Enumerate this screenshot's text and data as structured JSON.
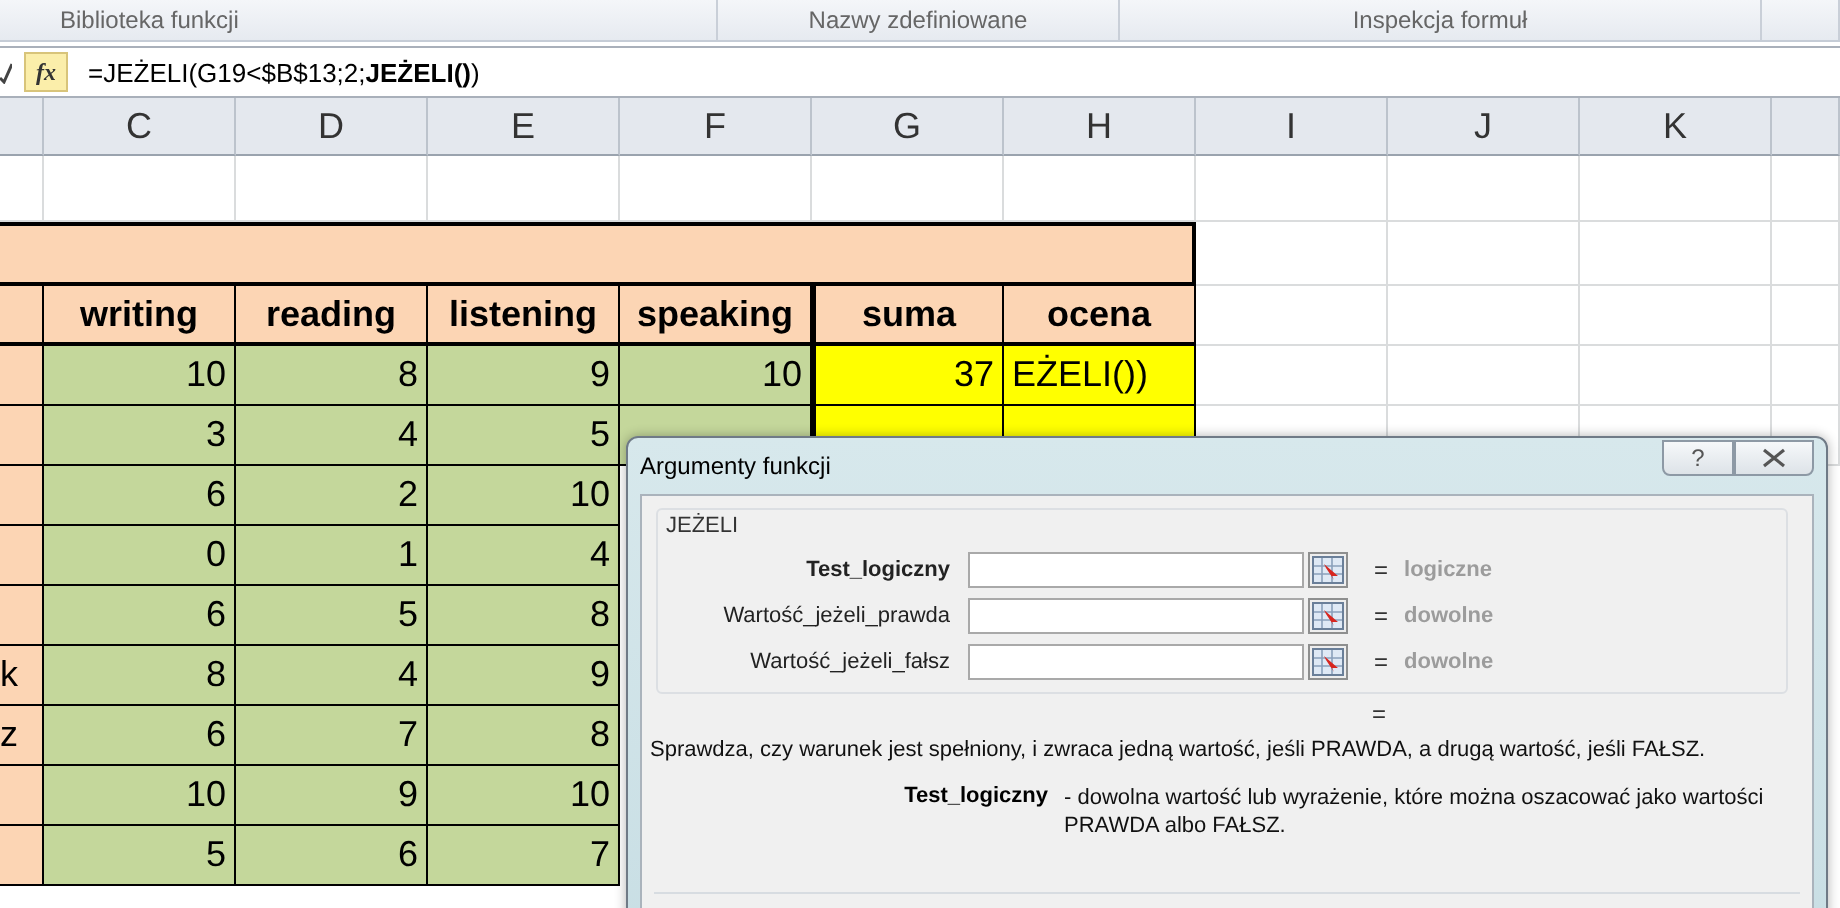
{
  "ribbon": {
    "groups": [
      "Biblioteka funkcji",
      "Nazwy zdefiniowane",
      "Inspekcja formuł"
    ]
  },
  "formula_bar": {
    "function_button": "fx",
    "formula": "=JEŻELI(G19<$B$13;2;**JEŻELI()**)"
  },
  "sheet": {
    "column_headers": [
      "C",
      "D",
      "E",
      "F",
      "G",
      "H",
      "I",
      "J",
      "K"
    ],
    "header_row": [
      "writing",
      "reading",
      "listening",
      "speaking",
      "suma",
      "ocena"
    ],
    "rows": [
      {
        "column_b": "",
        "values": [
          "10",
          "8",
          "9",
          "10",
          "37",
          "EŻELI())"
        ]
      },
      {
        "column_b": "",
        "values": [
          "3",
          "4",
          "5"
        ]
      },
      {
        "column_b": "",
        "values": [
          "6",
          "2",
          "10"
        ]
      },
      {
        "column_b": "",
        "values": [
          "0",
          "1",
          "4"
        ]
      },
      {
        "column_b": "",
        "values": [
          "6",
          "5",
          "8"
        ]
      },
      {
        "column_b": "k",
        "values": [
          "8",
          "4",
          "9"
        ]
      },
      {
        "column_b": "z",
        "values": [
          "6",
          "7",
          "8"
        ]
      },
      {
        "column_b": "",
        "values": [
          "10",
          "9",
          "10"
        ]
      },
      {
        "column_b": "",
        "values": [
          "5",
          "6",
          "7"
        ]
      }
    ]
  },
  "dialog": {
    "title": "Argumenty funkcji",
    "help_button": "?",
    "function_name": "JEŻELI",
    "arguments": [
      {
        "label": "Test_logiczny",
        "bold": true,
        "result": "logiczne"
      },
      {
        "label": "Wartość_jeżeli_prawda",
        "bold": false,
        "result": "dowolne"
      },
      {
        "label": "Wartość_jeżeli_fałsz",
        "bold": false,
        "result": "dowolne"
      }
    ],
    "result_sign": "=",
    "description": "Sprawdza, czy warunek jest spełniony, i zwraca jedną wartość, jeśli PRAWDA, a drugą wartość, jeśli FAŁSZ.",
    "argument_name": "Test_logiczny",
    "argument_help": "- dowolna wartość lub wyrażenie, które można oszacować jako wartości PRAWDA albo FAŁSZ."
  }
}
